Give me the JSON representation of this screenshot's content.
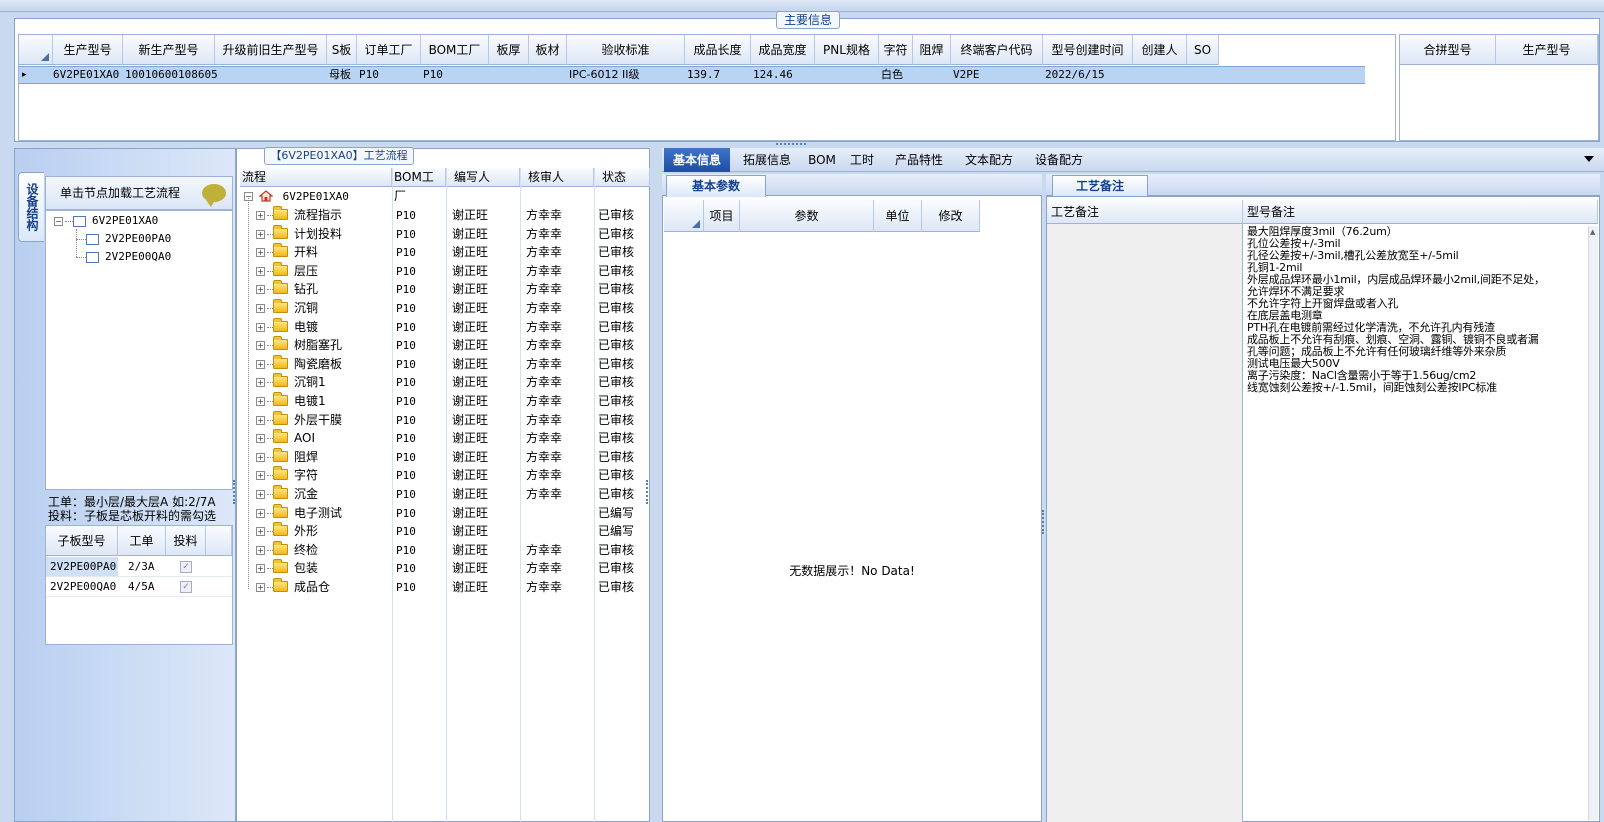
{
  "main_group": {
    "title": "主要信息",
    "columns": [
      "生产型号",
      "新生产型号",
      "升级前旧生产型号",
      "S板",
      "订单工厂",
      "BOM工厂",
      "板厚",
      "板材",
      "验收标准",
      "成品长度",
      "成品宽度",
      "PNL规格",
      "字符",
      "阻焊",
      "终端客户代码",
      "型号创建时间",
      "创建人",
      "SO"
    ],
    "row": {
      "生产型号": "6V2PE01XA0",
      "新生产型号": "10010600108605",
      "升级前旧生产型号": "",
      "S板": "母板",
      "订单工厂": "P10",
      "BOM工厂": "P10",
      "板厚": "",
      "板材": "",
      "验收标准": "IPC-6012 II级",
      "成品长度": "139.7",
      "成品宽度": "124.46",
      "PNL规格": "",
      "字符": "白色",
      "阻焊": "",
      "终端客户代码": "V2PE",
      "型号创建时间": "2022/6/15",
      "创建人": "",
      "SO": ""
    },
    "merge_columns": [
      "合拼型号",
      "生产型号"
    ]
  },
  "left_pane": {
    "vertical_tab": "设备结构",
    "node_hint": "单击节点加载工艺流程",
    "tree": [
      {
        "label": "6V2PE01XA0",
        "level": 0
      },
      {
        "label": "2V2PE00PA0",
        "level": 1
      },
      {
        "label": "2V2PE00QA0",
        "level": 1
      }
    ],
    "layer_info_line1": "工单：最小层/最大层A 如:2/7A",
    "layer_info_line2": "投料：子板是芯板开料的需勾选",
    "sub_columns": [
      "子板型号",
      "工单",
      "投料"
    ],
    "sub_rows": [
      {
        "model": "2V2PE00PA0",
        "order": "2/3A",
        "feed": "✓"
      },
      {
        "model": "2V2PE00QA0",
        "order": "4/5A",
        "feed": "✓"
      }
    ]
  },
  "flow": {
    "title": "【6V2PE01XA0】工艺流程",
    "columns": [
      "流程",
      "BOM工厂",
      "编写人",
      "核审人",
      "状态"
    ],
    "root": "6V2PE01XA0",
    "rows": [
      {
        "name": "流程指示",
        "factory": "P10",
        "writer": "谢正旺",
        "reviewer": "方幸幸",
        "status": "已审核"
      },
      {
        "name": "计划投料",
        "factory": "P10",
        "writer": "谢正旺",
        "reviewer": "方幸幸",
        "status": "已审核"
      },
      {
        "name": "开料",
        "factory": "P10",
        "writer": "谢正旺",
        "reviewer": "方幸幸",
        "status": "已审核"
      },
      {
        "name": "层压",
        "factory": "P10",
        "writer": "谢正旺",
        "reviewer": "方幸幸",
        "status": "已审核"
      },
      {
        "name": "钻孔",
        "factory": "P10",
        "writer": "谢正旺",
        "reviewer": "方幸幸",
        "status": "已审核"
      },
      {
        "name": "沉铜",
        "factory": "P10",
        "writer": "谢正旺",
        "reviewer": "方幸幸",
        "status": "已审核"
      },
      {
        "name": "电镀",
        "factory": "P10",
        "writer": "谢正旺",
        "reviewer": "方幸幸",
        "status": "已审核"
      },
      {
        "name": "树脂塞孔",
        "factory": "P10",
        "writer": "谢正旺",
        "reviewer": "方幸幸",
        "status": "已审核"
      },
      {
        "name": "陶瓷磨板",
        "factory": "P10",
        "writer": "谢正旺",
        "reviewer": "方幸幸",
        "status": "已审核"
      },
      {
        "name": "沉铜1",
        "factory": "P10",
        "writer": "谢正旺",
        "reviewer": "方幸幸",
        "status": "已审核"
      },
      {
        "name": "电镀1",
        "factory": "P10",
        "writer": "谢正旺",
        "reviewer": "方幸幸",
        "status": "已审核"
      },
      {
        "name": "外层干膜",
        "factory": "P10",
        "writer": "谢正旺",
        "reviewer": "方幸幸",
        "status": "已审核"
      },
      {
        "name": "AOI",
        "factory": "P10",
        "writer": "谢正旺",
        "reviewer": "方幸幸",
        "status": "已审核"
      },
      {
        "name": "阻焊",
        "factory": "P10",
        "writer": "谢正旺",
        "reviewer": "方幸幸",
        "status": "已审核"
      },
      {
        "name": "字符",
        "factory": "P10",
        "writer": "谢正旺",
        "reviewer": "方幸幸",
        "status": "已审核"
      },
      {
        "name": "沉金",
        "factory": "P10",
        "writer": "谢正旺",
        "reviewer": "方幸幸",
        "status": "已审核"
      },
      {
        "name": "电子测试",
        "factory": "P10",
        "writer": "谢正旺",
        "reviewer": "",
        "status": "已编写"
      },
      {
        "name": "外形",
        "factory": "P10",
        "writer": "谢正旺",
        "reviewer": "",
        "status": "已编写"
      },
      {
        "name": "终检",
        "factory": "P10",
        "writer": "谢正旺",
        "reviewer": "方幸幸",
        "status": "已审核"
      },
      {
        "name": "包装",
        "factory": "P10",
        "writer": "谢正旺",
        "reviewer": "方幸幸",
        "status": "已审核"
      },
      {
        "name": "成品仓",
        "factory": "P10",
        "writer": "谢正旺",
        "reviewer": "方幸幸",
        "status": "已审核"
      }
    ]
  },
  "tabs": [
    "基本信息",
    "拓展信息",
    "BOM",
    "工时",
    "产品特性",
    "文本配方",
    "设备配方"
  ],
  "basic": {
    "subtab": "基本参数",
    "columns": [
      "项目",
      "参数",
      "单位",
      "修改"
    ],
    "no_data": "无数据展示！No Data!"
  },
  "craft": {
    "subtab": "工艺备注",
    "col_left": "工艺备注",
    "col_right": "型号备注",
    "remarks": [
      "最大阻焊厚度3mil（76.2um）",
      "孔位公差按+/-3mil",
      "孔径公差按+/-3mil,槽孔公差放宽至+/-5mil",
      "孔铜1-2mil",
      "外层成品焊环最小1mil，内层成品焊环最小2mil,间距不足处，",
      "允许焊环不满足要求",
      "不允许字符上开窗焊盘或者入孔",
      "在底层盖电测章",
      "PTH孔在电镀前需经过化学清洗，不允许孔内有残渣",
      "成品板上不允许有刮痕、划痕、空洞、露铜、镀铜不良或者漏",
      "孔等问题；成品板上不允许有任何玻璃纤维等外来杂质",
      "测试电压最大500V",
      "离子污染度：NaCl含量需小于等于1.56ug/cm2",
      "线宽蚀刻公差按+/-1.5mil，间距蚀刻公差按IPC标准"
    ]
  }
}
